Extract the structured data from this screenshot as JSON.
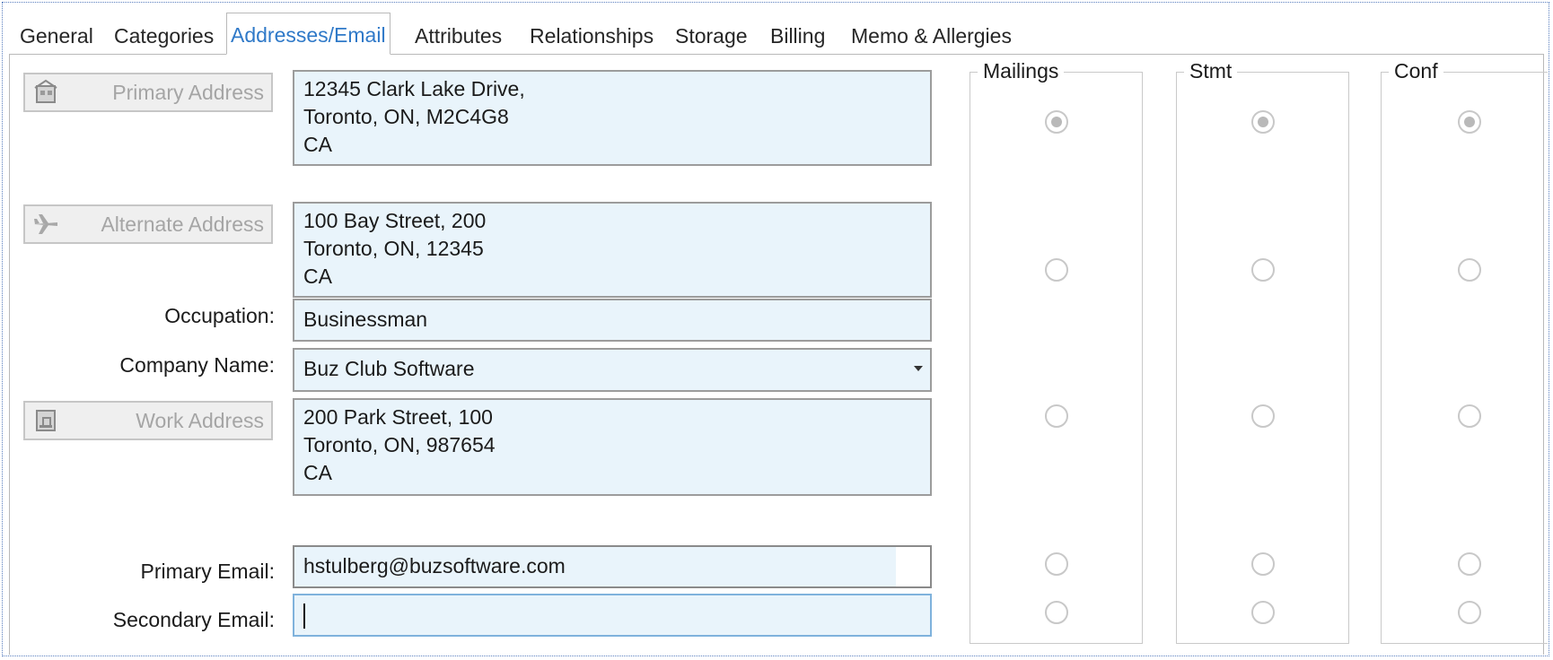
{
  "tabs": [
    {
      "label": "General",
      "active": false
    },
    {
      "label": "Categories",
      "active": false
    },
    {
      "label": "Addresses/Email",
      "active": true
    },
    {
      "label": "Attributes",
      "active": false
    },
    {
      "label": "Relationships",
      "active": false
    },
    {
      "label": "Storage",
      "active": false
    },
    {
      "label": "Billing",
      "active": false
    },
    {
      "label": "Memo & Allergies",
      "active": false
    }
  ],
  "addresses": {
    "primary": {
      "button_label": "Primary Address",
      "icon": "house-icon",
      "lines": [
        "12345 Clark Lake Drive,",
        "Toronto, ON, M2C4G8",
        "CA"
      ]
    },
    "alternate": {
      "button_label": "Alternate Address",
      "icon": "airplane-icon",
      "lines": [
        "100 Bay Street, 200",
        "Toronto, ON, 12345",
        "CA"
      ]
    },
    "work": {
      "button_label": "Work Address",
      "icon": "office-icon",
      "lines": [
        "200 Park Street, 100",
        "Toronto, ON, 987654",
        "CA"
      ]
    }
  },
  "fields": {
    "occupation": {
      "label": "Occupation:",
      "value": "Businessman"
    },
    "company": {
      "label": "Company Name:",
      "value": "Buz Club Software"
    },
    "primary_email": {
      "label": "Primary Email:",
      "value": "hstulberg@buzsoftware.com"
    },
    "secondary_email": {
      "label": "Secondary Email:",
      "value": ""
    }
  },
  "preference_groups": [
    {
      "title": "Mailings",
      "selected_row": "primary"
    },
    {
      "title": "Stmt",
      "selected_row": "primary"
    },
    {
      "title": "Conf",
      "selected_row": "primary"
    }
  ],
  "preference_rows": [
    "primary",
    "alternate",
    "work",
    "primary_email",
    "secondary_email"
  ],
  "colors": {
    "accent": "#2f79c8",
    "field_bg": "#e9f4fb"
  }
}
